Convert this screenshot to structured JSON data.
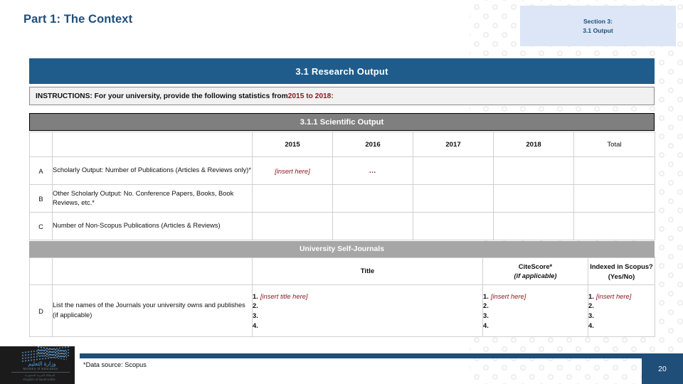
{
  "header": {
    "title": "Part 1: The Context",
    "section_tag_line1": "Section 3:",
    "section_tag_line2": "3.1 Output"
  },
  "banners": {
    "main": "3.1 Research Output",
    "sub": "3.1.1 Scientific Output",
    "self_journals": "University Self-Journals"
  },
  "instructions": {
    "text": "INSTRUCTIONS: For your university, provide the following statistics from ",
    "highlight": "2015 to 2018:"
  },
  "output_table": {
    "columns": [
      "2015",
      "2016",
      "2017",
      "2018",
      "Total"
    ],
    "rows": [
      {
        "letter": "A",
        "label": "Scholarly Output: Number of Publications (Articles & Reviews only)*",
        "values": [
          "[insert here]",
          "…",
          "",
          "",
          ""
        ]
      },
      {
        "letter": "B",
        "label": "Other Scholarly Output: No. Conference Papers, Books, Book Reviews, etc.*",
        "values": [
          "",
          "",
          "",
          "",
          ""
        ]
      },
      {
        "letter": "C",
        "label": "Number of Non-Scopus Publications (Articles & Reviews)",
        "values": [
          "",
          "",
          "",
          "",
          ""
        ]
      }
    ]
  },
  "journals_table": {
    "col_title": "Title",
    "col_citescore_line1": "CiteScore*",
    "col_citescore_line2": "(if applicable)",
    "col_indexed_line1": "Indexed in Scopus?",
    "col_indexed_line2": "(Yes/No)",
    "row": {
      "letter": "D",
      "label": "List the names of the Journals your university owns and publishes (if applicable)",
      "title_items": [
        {
          "num": "1.",
          "text": "[insert title here]"
        },
        {
          "num": "2.",
          "text": ""
        },
        {
          "num": "3.",
          "text": ""
        },
        {
          "num": "4.",
          "text": ""
        }
      ],
      "citescore_items": [
        {
          "num": "1.",
          "text": "[insert here]"
        },
        {
          "num": "2.",
          "text": ""
        },
        {
          "num": "3.",
          "text": ""
        },
        {
          "num": "4.",
          "text": ""
        }
      ],
      "indexed_items": [
        {
          "num": "1.",
          "text": "[insert here]"
        },
        {
          "num": "2.",
          "text": ""
        },
        {
          "num": "3.",
          "text": ""
        },
        {
          "num": "4.",
          "text": ""
        }
      ]
    }
  },
  "footer": {
    "footnote": "*Data source: Scopus",
    "page_number": "20"
  },
  "logo": {
    "arabic": "وزارة التعليم",
    "english": "Ministry of Education",
    "sub1": "المملكة العربية السعودية",
    "sub2": "Kingdom of Saudi Arabia"
  },
  "colors": {
    "brand_blue": "#1F4E79",
    "banner_blue": "#1F5C8B",
    "banner_gray": "#7F7F7F",
    "selfjournal_gray": "#A6A6A6",
    "accent_maroon": "#8B1A22",
    "tag_blue": "#DCE6F6"
  }
}
